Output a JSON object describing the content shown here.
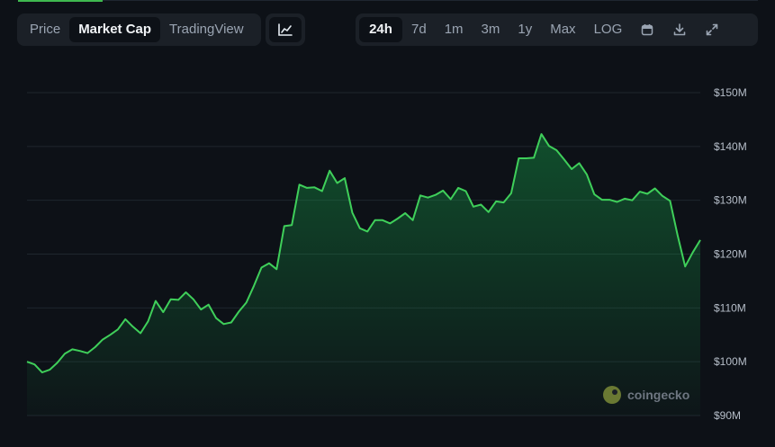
{
  "tabs": {
    "price": "Price",
    "market_cap": "Market Cap",
    "tradingview": "TradingView"
  },
  "ranges": {
    "h24": "24h",
    "d7": "7d",
    "m1": "1m",
    "m3": "3m",
    "y1": "1y",
    "max": "Max",
    "log": "LOG"
  },
  "icons": {
    "chart_type": "line-chart-icon",
    "calendar": "calendar-icon",
    "download": "download-icon",
    "fullscreen": "expand-icon"
  },
  "watermark": "coingecko",
  "colors": {
    "line": "#3fcf5a",
    "fill": "#15803d",
    "accent": "#3fb950",
    "background": "#0d1117"
  },
  "chart_data": {
    "type": "area",
    "title": "",
    "xlabel": "",
    "ylabel": "",
    "y_unit": "USD",
    "ylim": [
      90,
      150
    ],
    "y_ticks": [
      150,
      140,
      130,
      120,
      110,
      100,
      90
    ],
    "y_tick_labels": [
      "$150M",
      "$140M",
      "$130M",
      "$120M",
      "$110M",
      "$100M",
      "$90M"
    ],
    "grid": true,
    "legend": "none",
    "series": [
      {
        "values": [
          100,
          99.5,
          98,
          98.5,
          99.8,
          101.5,
          102.3,
          102,
          101.6,
          102.7,
          104.1,
          105,
          106,
          107.9,
          106.5,
          105.3,
          107.5,
          111.3,
          109.2,
          111.6,
          111.5,
          112.9,
          111.6,
          109.7,
          110.6,
          108.1,
          107,
          107.3,
          109.3,
          111,
          114.1,
          117.5,
          118.3,
          117.2,
          125.2,
          125.4,
          132.9,
          132.3,
          132.4,
          131.7,
          135.5,
          133.2,
          134.1,
          127.7,
          124.8,
          124.2,
          126.3,
          126.3,
          125.7,
          126.6,
          127.6,
          126.3,
          130.9,
          130.5,
          131,
          131.8,
          130.2,
          132.3,
          131.7,
          128.8,
          129.2,
          127.8,
          129.8,
          129.6,
          131.3,
          137.8,
          137.8,
          137.9,
          142.3,
          140.1,
          139.3,
          137.6,
          135.8,
          136.9,
          134.8,
          131.1,
          130.1,
          130.1,
          129.7,
          130.3,
          130,
          131.6,
          131.2,
          132.2,
          130.8,
          129.9,
          123.5,
          117.7,
          120.3,
          122.6
        ]
      }
    ]
  }
}
